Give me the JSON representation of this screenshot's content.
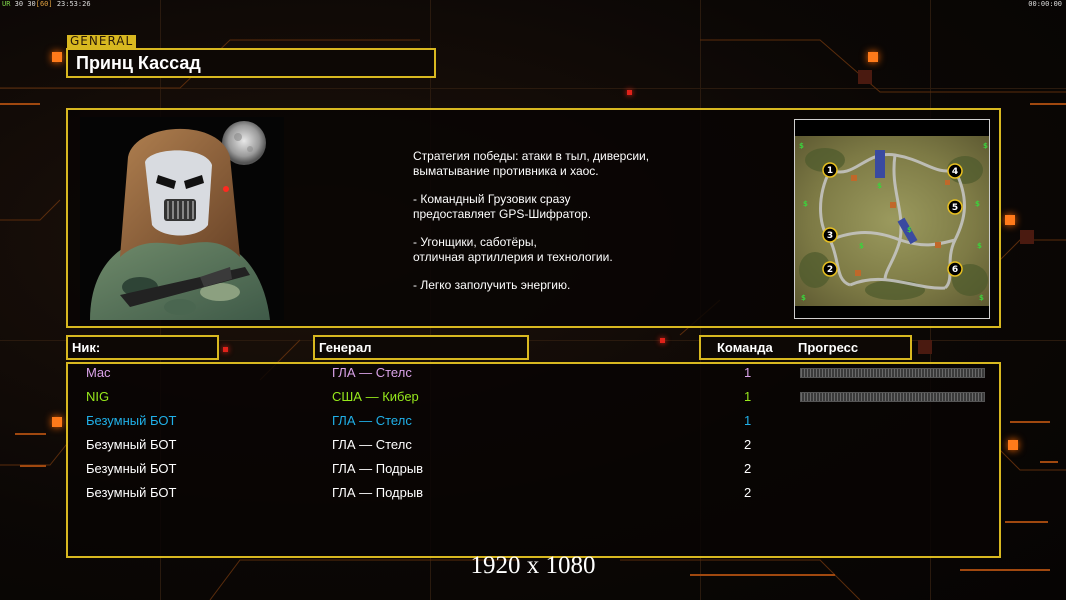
{
  "overlay": {
    "fps_prefix": "UR",
    "fps_a": "30",
    "fps_b": "30",
    "fps_c": "[60]",
    "clock_left": "23:53:26",
    "clock_right": "00:00:00"
  },
  "general": {
    "tag": "GENERAL",
    "name": "Принц Кассад",
    "description": [
      "Стратегия победы: атаки в тыл, диверсии,\n выматывание противника и хаос.",
      "- Командный Грузовик сразу\nпредоставляет GPS-Шифратор.",
      "- Угонщики, саботёры,\nотличная артиллерия и технологии.",
      "- Легко заполучить энергию."
    ]
  },
  "minimap": {
    "start_positions": [
      "1",
      "2",
      "3",
      "4",
      "5",
      "6"
    ]
  },
  "table": {
    "headers": {
      "nick": "Ник:",
      "general": "Генерал",
      "team": "Команда",
      "progress": "Прогресс"
    },
    "rows": [
      {
        "name": "Mac",
        "general": "ГЛА — Стелс",
        "team": "1",
        "color": "#d9a2e8",
        "progress_bar": true
      },
      {
        "name": "NIG",
        "general": "США — Кибер",
        "team": "1",
        "color": "#96e81c",
        "progress_bar": true
      },
      {
        "name": "Безумный БОТ",
        "general": "ГЛА — Стелс",
        "team": "1",
        "color": "#20b0e8",
        "progress_bar": false
      },
      {
        "name": "Безумный БОТ",
        "general": "ГЛА — Стелс",
        "team": "2",
        "color": "#ffffff",
        "progress_bar": false
      },
      {
        "name": "Безумный БОТ",
        "general": "ГЛА — Подрыв",
        "team": "2",
        "color": "#ffffff",
        "progress_bar": false
      },
      {
        "name": "Безумный БОТ",
        "general": "ГЛА — Подрыв",
        "team": "2",
        "color": "#ffffff",
        "progress_bar": false
      }
    ]
  },
  "footer": {
    "resolution": "1920 x 1080"
  },
  "colors": {
    "frame": "#d8b820",
    "accent": "#ff7a1a"
  }
}
